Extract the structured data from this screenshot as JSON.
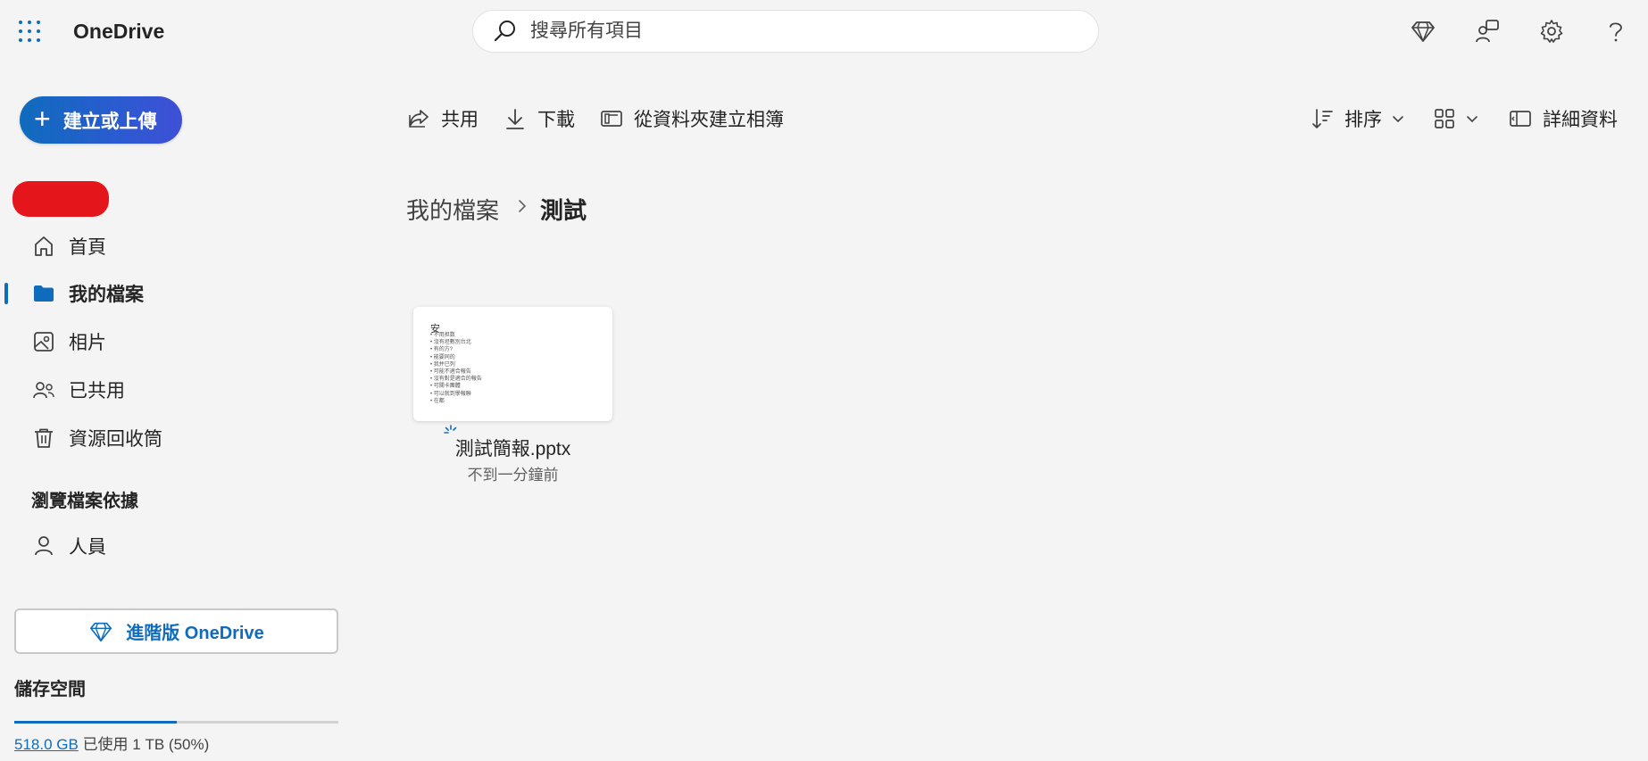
{
  "header": {
    "app_title": "OneDrive",
    "search_placeholder": "搜尋所有項目",
    "icons": [
      "waffle-icon",
      "diamond-icon",
      "feedback-icon",
      "gear-icon",
      "help-icon"
    ]
  },
  "sidebar": {
    "create_label": "建立或上傳",
    "nav_items": [
      {
        "label": "首頁",
        "icon": "home-icon"
      },
      {
        "label": "我的檔案",
        "icon": "folder-icon",
        "active": true
      },
      {
        "label": "相片",
        "icon": "photo-icon"
      },
      {
        "label": "已共用",
        "icon": "people-icon"
      },
      {
        "label": "資源回收筒",
        "icon": "trash-icon"
      }
    ],
    "browse_header": "瀏覽檔案依據",
    "browse_items": [
      {
        "label": "人員",
        "icon": "person-icon"
      }
    ],
    "premium_label": "進階版 OneDrive",
    "storage": {
      "title": "儲存空間",
      "used": "518.0 GB",
      "detail": "已使用 1 TB (50%)",
      "percent": 50
    }
  },
  "commands": {
    "share": "共用",
    "download": "下載",
    "create_album": "從資料夾建立相簿",
    "sort": "排序",
    "details": "詳細資料"
  },
  "breadcrumb": {
    "parent": "我的檔案",
    "current": "測試"
  },
  "files": [
    {
      "name": "測試簡報.pptx",
      "modified": "不到一分鐘前",
      "thumbnail": {
        "title": "安",
        "bullets": [
          "不用担数",
          "沒有坦數別台北",
          "有的方?",
          "能要同的",
          "我并已列",
          "可能不適合報告",
          "沒有對是適合的報告",
          "可關卡團體",
          "可以就到學報聯",
          "在都"
        ]
      }
    }
  ],
  "colors": {
    "accent": "#0f6cbd",
    "background": "#f4f4f4",
    "redaction": "#e4161c"
  }
}
